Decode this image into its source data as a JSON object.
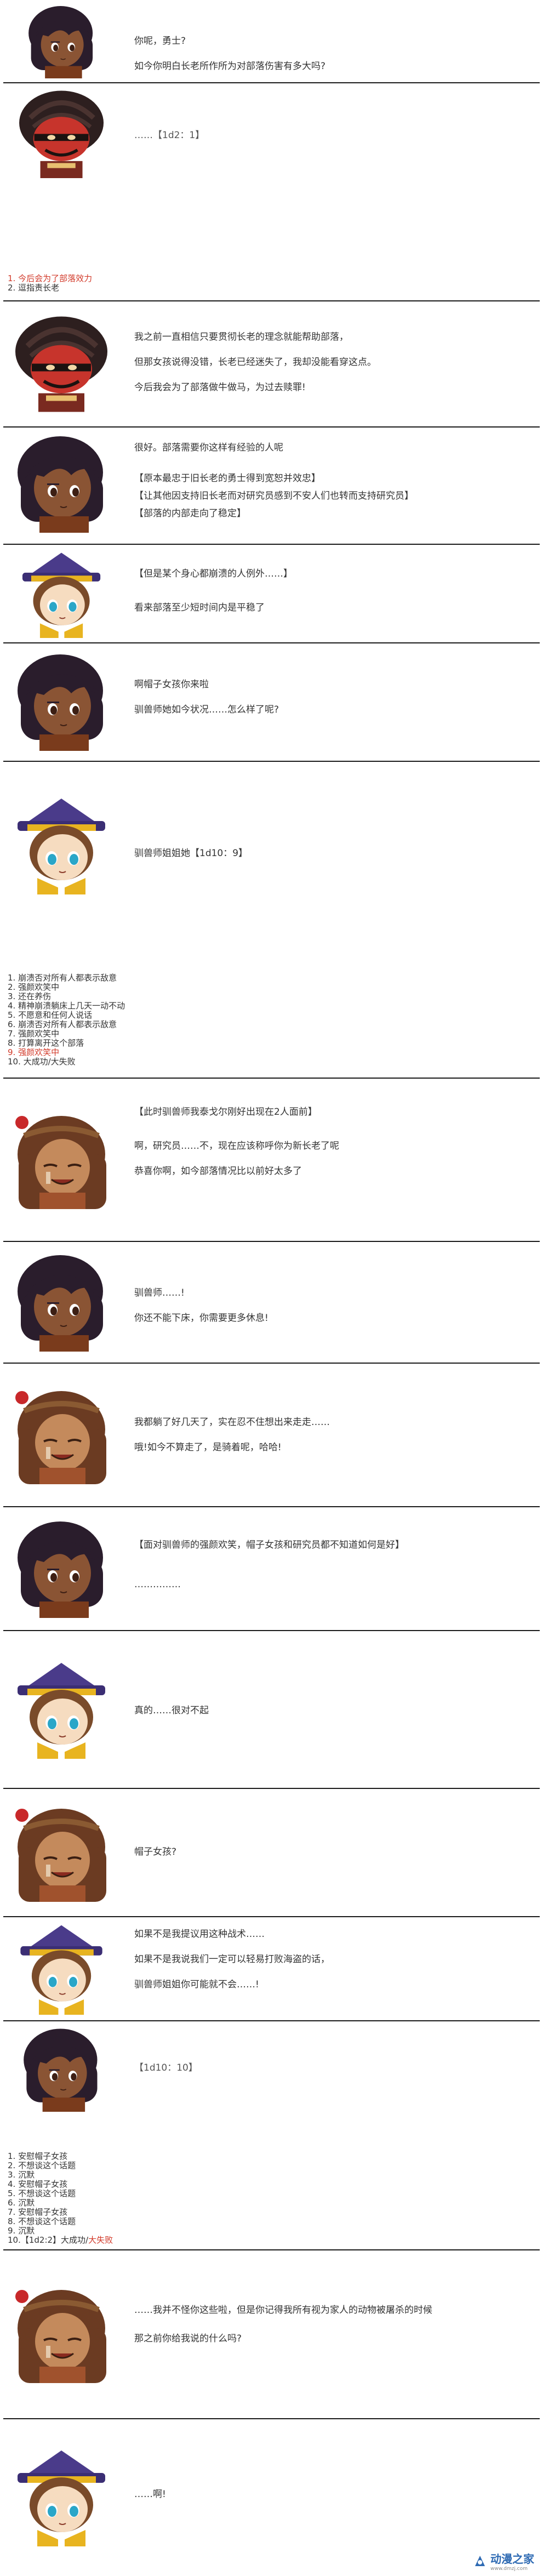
{
  "p1": {
    "lines": [
      "你呢，勇士?",
      "如今你明白长老所作所为对部落伤害有多大吗?"
    ]
  },
  "p2": {
    "lines": [
      "……【1d2：1】"
    ]
  },
  "list1": {
    "items": [
      "1.  今后会为了部落效力",
      "2.  逗指责长老"
    ]
  },
  "p3": {
    "lines": [
      "我之前一直相信只要贯彻长老的理念就能帮助部落，",
      "但那女孩说得没错，长老已经迷失了，我却没能看穿这点。",
      "今后我会为了部落做牛做马，为过去赎罪!"
    ]
  },
  "p4": {
    "lines": [
      "很好。部落需要你这样有经验的人呢",
      "【原本最忠于旧长老的勇士得到宽恕并效忠】",
      "【让其他因支持旧长老而对研究员感到不安人们也转而支持研究员】",
      "【部落的内部走向了稳定】"
    ]
  },
  "p5": {
    "lines": [
      "【但是某个身心都崩溃的人例外……】",
      "看来部落至少短时间内是平稳了"
    ]
  },
  "p6": {
    "lines": [
      "啊帽子女孩你来啦",
      "驯兽师她如今状况……怎么样了呢?"
    ]
  },
  "p7": {
    "lines": [
      "驯兽师姐姐她【1d10：9】"
    ]
  },
  "list2": {
    "items": [
      "1.  崩溃否对所有人都表示敌意",
      "2.  强颜欢笑中",
      "3.  还在养伤",
      "4.  精神崩溃躺床上几天一动不动",
      "5.  不愿意和任何人说话",
      "6.  崩溃否对所有人都表示敌意",
      "7.  强颜欢笑中",
      "8.  打算离开这个部落",
      "9.  强颜欢笑中",
      "10. 大成功/大失败"
    ]
  },
  "p8": {
    "lines": [
      "【此时驯兽师我泰戈尔刚好出现在2人面前】",
      "啊，研究员……不，现在应该称呼你为新长老了呢",
      "恭喜你啊，如今部落情况比以前好太多了"
    ]
  },
  "p9": {
    "lines": [
      "驯兽师……!",
      "你还不能下床，你需要更多休息!"
    ]
  },
  "p10": {
    "lines": [
      "我都躺了好几天了，实在忍不住想出来走走……",
      "哦!如今不算走了，是骑着呢，哈哈!"
    ]
  },
  "p11": {
    "lines": [
      "【面对驯兽师的强颜欢笑，帽子女孩和研究员都不知道如何是好】",
      "……………"
    ]
  },
  "p12": {
    "lines": [
      "真的……很对不起"
    ]
  },
  "p13": {
    "lines": [
      "帽子女孩?"
    ]
  },
  "p14": {
    "lines": [
      "如果不是我提议用这种战术……",
      "如果不是我说我们一定可以轻易打败海盗的话，",
      "驯兽师姐姐你可能就不会……!"
    ]
  },
  "p15": {
    "lines": [
      "【1d10：10】"
    ]
  },
  "list3": {
    "items": [
      "1.  安慰帽子女孩",
      "2.  不想谈这个话题",
      "3.  沉默",
      "4.  安慰帽子女孩",
      "5.  不想谈这个话题",
      "6.  沉默",
      "7.  安慰帽子女孩",
      "8.  不想谈这个话题",
      "9.  沉默",
      "10.【1d2:2】大成功/大失败"
    ]
  },
  "p16": {
    "lines": [
      "……我并不怪你这些啦，但是你记得我所有视为家人的动物被屠杀的时候",
      "那之前你给我说的什么吗?"
    ]
  },
  "p17": {
    "lines": [
      "……啊!"
    ]
  },
  "watermark": {
    "brand": "动漫之家",
    "url": "www.dmzj.com"
  },
  "colors": {
    "highlight_red": "#d23a2a",
    "separator": "#1a1a1a",
    "brand_blue": "#2e6ab3"
  }
}
